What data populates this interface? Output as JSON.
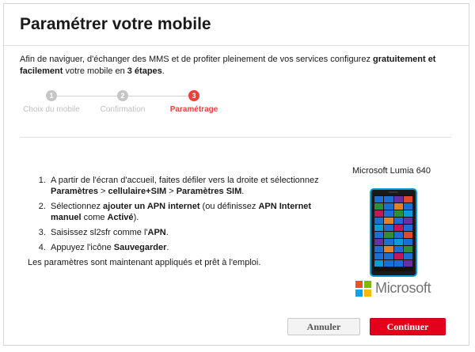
{
  "dialog": {
    "title": "Paramétrer votre mobile",
    "intro": {
      "p1": "Afin de naviguer, d'échanger des MMS et de profiter pleinement de vos services configurez ",
      "b1": "gratuitement et facilement",
      "p2": " votre mobile en ",
      "b2": "3 étapes",
      "p3": "."
    },
    "steps": [
      {
        "number": "1",
        "label": "Choix du mobile"
      },
      {
        "number": "2",
        "label": "Confirmation"
      },
      {
        "number": "3",
        "label": "Paramétrage"
      }
    ],
    "instructions": [
      {
        "t1": "A partir de l'écran d'accueil, faites défiler vers la droite et sélectionnez ",
        "b1": "Paramètres",
        "t2": " > ",
        "b2": "cellulaire+SIM",
        "t3": " > ",
        "b3": "Paramètres SIM",
        "t4": "."
      },
      {
        "t1": "Sélectionnez ",
        "b1": "ajouter un APN internet",
        "t2": " (ou définissez ",
        "b2": "APN Internet manuel",
        "t3": " come ",
        "b3": "Activé",
        "t4": ")."
      },
      {
        "t1": "Saisissez sl2sfr comme l'",
        "b1": "APN",
        "t2": "."
      },
      {
        "t1": "Appuyez l'icône ",
        "b1": "Sauvegarder",
        "t2": "."
      }
    ],
    "footer_note": "Les paramètres sont maintenant appliqués et prêt à l'emploi.",
    "device_name": "Microsoft Lumia 640",
    "brand": "Microsoft",
    "buttons": {
      "cancel": "Annuler",
      "continue": "Continuer"
    }
  },
  "colors": {
    "accent": "#e8423a",
    "continue_button": "#e2001a",
    "phone_frame": "#0a9bd8"
  }
}
